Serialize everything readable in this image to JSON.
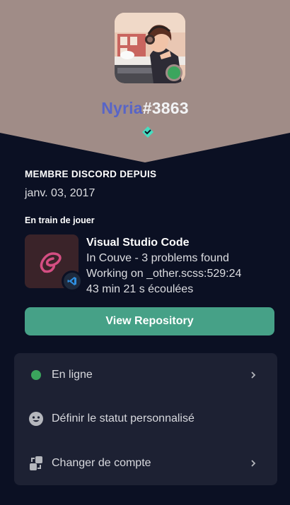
{
  "profile": {
    "username": "Nyria",
    "discriminator": "#3863",
    "status": "online",
    "name_color": "#5865c7",
    "banner_color": "#a08c87"
  },
  "member_since": {
    "title": "MEMBRE DISCORD DEPUIS",
    "date": "janv. 03, 2017"
  },
  "activity": {
    "section_title": "En train de jouer",
    "app_name": "Visual Studio Code",
    "details": "In Couve - 3 problems found",
    "state": "Working on _other.scss:529:24",
    "elapsed": "43 min 21 s écoulées",
    "large_icon": "sass-icon",
    "small_icon": "vscode-icon",
    "button_label": "View Repository",
    "button_color": "#46a187"
  },
  "menu": {
    "items": [
      {
        "label": "En ligne",
        "icon": "online-status-dot",
        "chevron": true
      },
      {
        "label": "Définir le statut personnalisé",
        "icon": "smiley-icon",
        "chevron": false
      },
      {
        "label": "Changer de compte",
        "icon": "switch-account-icon",
        "chevron": true
      }
    ]
  }
}
